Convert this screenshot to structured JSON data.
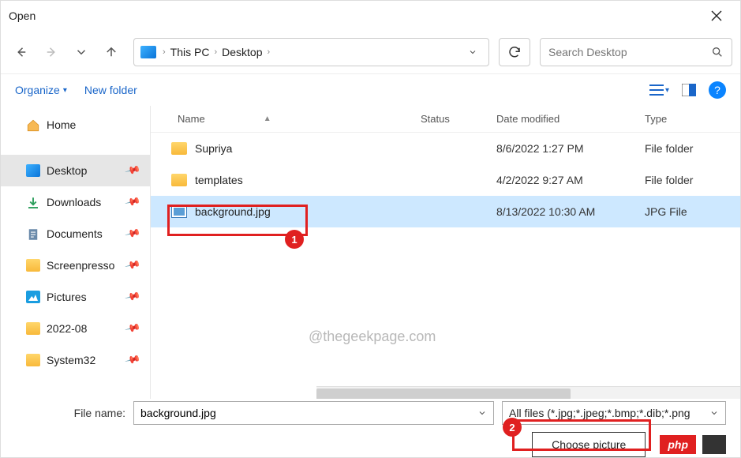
{
  "window": {
    "title": "Open"
  },
  "breadcrumb": {
    "root": "This PC",
    "folder": "Desktop"
  },
  "search": {
    "placeholder": "Search Desktop"
  },
  "toolbar": {
    "organize": "Organize",
    "newfolder": "New folder",
    "help": "?"
  },
  "sidebar": {
    "items": [
      {
        "label": "Home"
      },
      {
        "label": "Desktop"
      },
      {
        "label": "Downloads"
      },
      {
        "label": "Documents"
      },
      {
        "label": "Screenpresso"
      },
      {
        "label": "Pictures"
      },
      {
        "label": "2022-08"
      },
      {
        "label": "System32"
      }
    ]
  },
  "columns": {
    "name": "Name",
    "status": "Status",
    "date": "Date modified",
    "type": "Type"
  },
  "files": [
    {
      "name": "Supriya",
      "date": "8/6/2022 1:27 PM",
      "type": "File folder"
    },
    {
      "name": "templates",
      "date": "4/2/2022 9:27 AM",
      "type": "File folder"
    },
    {
      "name": "background.jpg",
      "date": "8/13/2022 10:30 AM",
      "type": "JPG File"
    }
  ],
  "footer": {
    "label": "File name:",
    "value": "background.jpg",
    "filter": "All files (*.jpg;*.jpeg;*.bmp;*.dib;*.png",
    "choose": "Choose picture"
  },
  "badges": {
    "one": "1",
    "two": "2"
  },
  "watermark": "@thegeekpage.com",
  "php": "php"
}
